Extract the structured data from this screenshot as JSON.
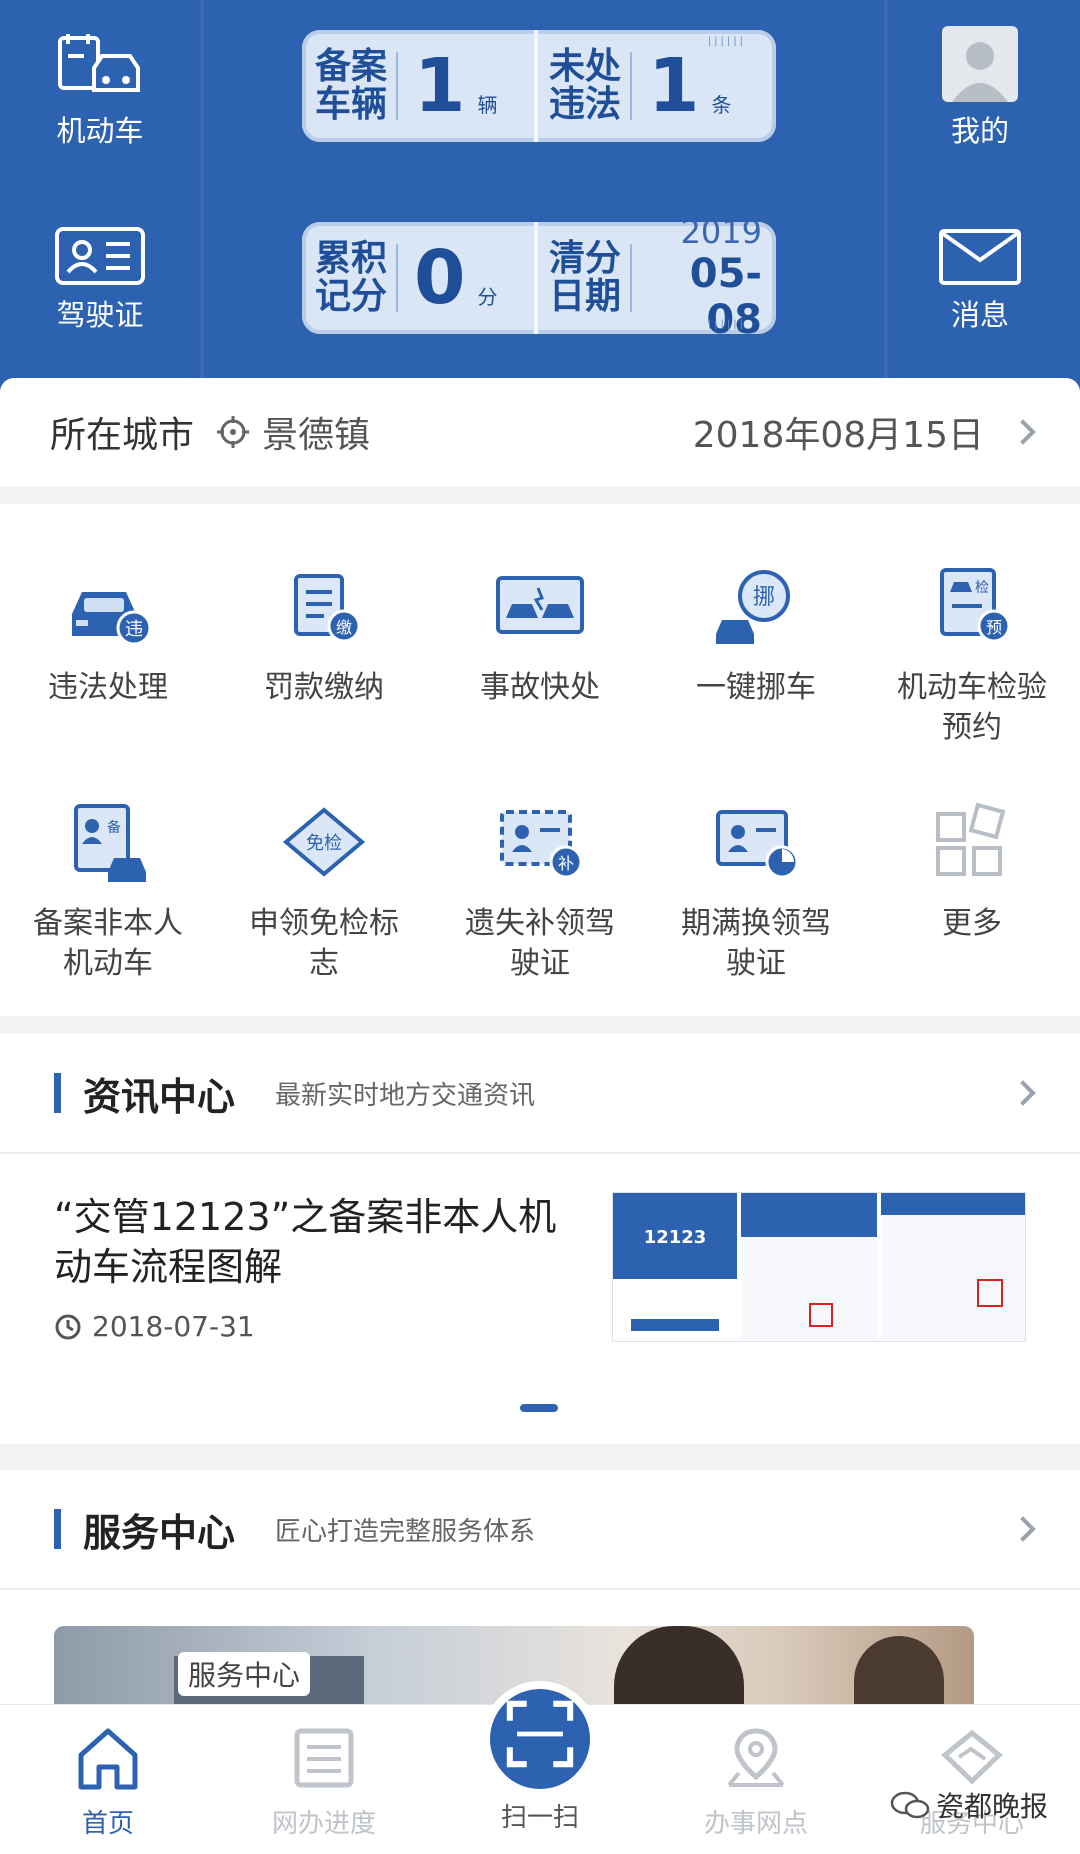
{
  "colors": {
    "primary": "#2d62b0",
    "panel": "#dae6f5",
    "muted": "#bfc4ca"
  },
  "header": {
    "vehicle_label": "机动车",
    "license_label": "驾驶证",
    "me_label": "我的",
    "message_label": "消息",
    "registered": {
      "label": "备案车辆",
      "value": "1",
      "unit": "辆"
    },
    "violations": {
      "label": "未处违法",
      "value": "1",
      "unit": "条"
    },
    "points": {
      "label": "累积记分",
      "value": "0",
      "unit": "分"
    },
    "clear_date": {
      "label": "清分日期",
      "year": "2019",
      "date": "05-08"
    }
  },
  "city": {
    "label": "所在城市",
    "name": "景德镇",
    "date": "2018年08月15日"
  },
  "services": [
    {
      "icon": "car-violation-icon",
      "label": "违法处理"
    },
    {
      "icon": "fine-payment-icon",
      "label": "罚款缴纳"
    },
    {
      "icon": "accident-icon",
      "label": "事故快处"
    },
    {
      "icon": "move-car-icon",
      "label": "一键挪车"
    },
    {
      "icon": "inspection-booking-icon",
      "label": "机动车检验预约"
    },
    {
      "icon": "non-owner-vehicle-icon",
      "label": "备案非本人机动车"
    },
    {
      "icon": "exempt-sign-icon",
      "label": "申领免检标志"
    },
    {
      "icon": "license-replace-icon",
      "label": "遗失补领驾驶证"
    },
    {
      "icon": "license-renew-icon",
      "label": "期满换领驾驶证"
    },
    {
      "icon": "more-icon",
      "label": "更多"
    }
  ],
  "news": {
    "title": "资讯中心",
    "subtitle": "最新实时地方交通资讯",
    "article_title": "“交管12123”之备案非本人机动车流程图解",
    "article_date": "2018-07-31",
    "thumb_brand": "12123"
  },
  "service_center": {
    "title": "服务中心",
    "subtitle": "匠心打造完整服务体系",
    "banner_tag": "服务中心"
  },
  "nav": [
    {
      "label": "首页",
      "icon": "home-icon"
    },
    {
      "label": "网办进度",
      "icon": "progress-icon"
    },
    {
      "label": "扫一扫",
      "icon": "scan-icon"
    },
    {
      "label": "办事网点",
      "icon": "location-icon"
    },
    {
      "label": "服务中心",
      "icon": "service-handshake-icon"
    }
  ],
  "watermark": "瓷都晚报"
}
